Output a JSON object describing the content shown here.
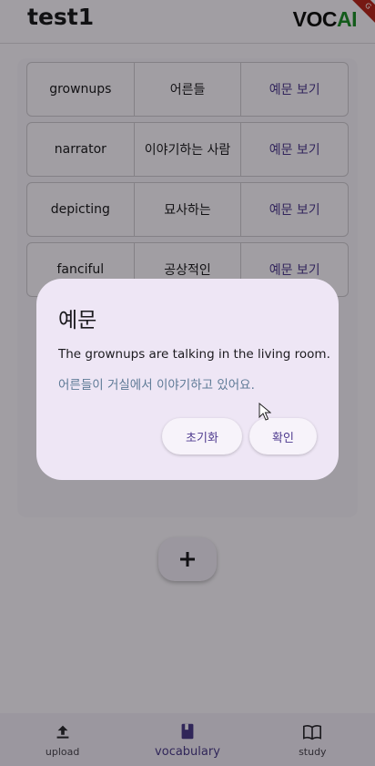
{
  "appbar": {
    "title": "test1",
    "logo_main": "VOC",
    "logo_accent": "AI",
    "debug_badge": "G"
  },
  "words": [
    {
      "word": "grownups",
      "meaning": "어른들",
      "action": "예문 보기"
    },
    {
      "word": "narrator",
      "meaning": "이야기하는 사람",
      "action": "예문 보기"
    },
    {
      "word": "depicting",
      "meaning": "묘사하는",
      "action": "예문 보기"
    },
    {
      "word": "fanciful",
      "meaning": "공상적인",
      "action": "예문 보기"
    }
  ],
  "fab": {
    "icon": "plus-icon"
  },
  "bottom_nav": [
    {
      "label": "upload",
      "icon": "upload-icon"
    },
    {
      "label": "vocabulary",
      "icon": "book-icon",
      "active": true
    },
    {
      "label": "study",
      "icon": "open-book-icon"
    }
  ],
  "dialog": {
    "title": "예문",
    "sentence": "The grownups are talking in the living room.",
    "translation": "어른들이 거실에서 이야기하고 있어요.",
    "reset_label": "초기화",
    "ok_label": "확인"
  },
  "colors": {
    "accent": "#4e3a8e",
    "logo_ai": "#1e8a2a",
    "translation": "#5e7a96"
  }
}
